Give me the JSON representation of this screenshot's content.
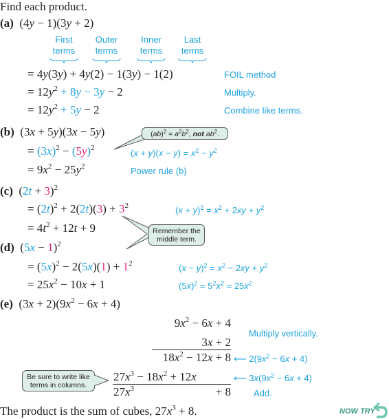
{
  "instruction": "Find each product.",
  "colors": {
    "accent_blue": "#1fa3e0",
    "accent_magenta": "#e4267d",
    "callout_fill": "#ddeee6",
    "now_try": "#3a9a84"
  },
  "part_a": {
    "label": "(a)",
    "problem": "(4y − 1)(3y + 2)",
    "foil_labels": [
      {
        "top": "First",
        "bottom": "terms"
      },
      {
        "top": "Outer",
        "bottom": "terms"
      },
      {
        "top": "Inner",
        "bottom": "terms"
      },
      {
        "top": "Last",
        "bottom": "terms"
      }
    ],
    "steps": [
      {
        "expr": "= 4y(3y) + 4y(2) − 1(3y) − 1(2)",
        "note": "FOIL method"
      },
      {
        "expr": "= 12y² + 8y − 3y − 2",
        "note": "Multiply."
      },
      {
        "expr": "= 12y² + 5y − 2",
        "note": "Combine like terms."
      }
    ]
  },
  "part_b": {
    "label": "(b)",
    "problem": "(3x + 5y)(3x − 5y)",
    "callout": "(ab)² = a²b², not ab².",
    "steps": [
      {
        "expr": "= (3x)² − (5y)²",
        "note": "(x + y)(x − y) = x² − y²"
      },
      {
        "expr": "= 9x² − 25y²",
        "note": "Power rule (b)"
      }
    ]
  },
  "part_c": {
    "label": "(c)",
    "problem": "(2t + 3)²",
    "callout": "Remember the middle term.",
    "steps": [
      {
        "expr": "= (2t)² + 2(2t)(3) + 3²",
        "note": "(x + y)² = x² + 2xy + y²"
      },
      {
        "expr": "= 4t² + 12t + 9",
        "note": ""
      }
    ]
  },
  "part_d": {
    "label": "(d)",
    "problem": "(5x − 1)²",
    "steps": [
      {
        "expr": "= (5x)² − 2(5x)(1) + 1²",
        "note": "(x − y)² = x² − 2xy + y²"
      },
      {
        "expr": "= 25x² − 10x + 1",
        "note": "(5x)² = 5²x² = 25x²"
      }
    ]
  },
  "part_e": {
    "label": "(e)",
    "problem": "(3x + 2)(9x² − 6x + 4)",
    "callout": "Be sure to write like terms in columns.",
    "vertical": {
      "row1": "9x² − 6x + 4",
      "row2": "3x + 2",
      "row3": "18x² − 12x + 8",
      "row4": "27x³ − 18x² + 12x",
      "row5_left": "27x³",
      "row5_right": "+ 8"
    },
    "notes": {
      "multiply": "Multiply vertically.",
      "row3": "← 2(9x² − 6x + 4)",
      "row4": "← 3x(9x² − 6x + 4)",
      "add": "Add."
    }
  },
  "conclusion": "The product is the sum of cubes, 27x³ + 8.",
  "now_try": "NOW TRY"
}
